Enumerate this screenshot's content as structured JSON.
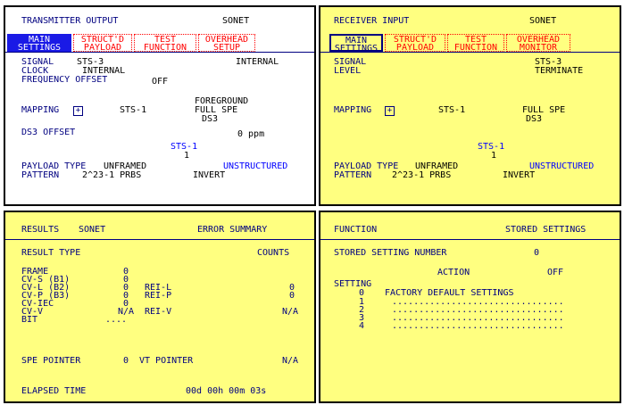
{
  "tx": {
    "title": "TRANSMITTER OUTPUT",
    "mode": "SONET",
    "tabs": [
      {
        "l1": "MAIN",
        "l2": "SETTINGS"
      },
      {
        "l1": "STRUCT'D",
        "l2": "PAYLOAD"
      },
      {
        "l1": "TEST",
        "l2": "FUNCTION"
      },
      {
        "l1": "OVERHEAD",
        "l2": "SETUP"
      }
    ],
    "signal_label": "SIGNAL",
    "signal_value": "STS-3",
    "signal_source": "INTERNAL",
    "clock_label": "CLOCK",
    "clock_value": "INTERNAL",
    "freq_label": "FREQUENCY OFFSET",
    "freq_value": "OFF",
    "fg1": "FOREGROUND",
    "fg2": "FULL SPE",
    "fg3": "DS3",
    "mapping_label": "MAPPING",
    "mapping_icon": "+",
    "mapping_value": "STS-1",
    "ds3_label": "DS3 OFFSET",
    "ds3_value": "0 ppm",
    "sts": "STS-1",
    "sts_num": "1",
    "payload_label": "PAYLOAD TYPE",
    "payload_value": "UNFRAMED",
    "payload_struct": "UNSTRUCTURED",
    "pattern_label": "PATTERN",
    "pattern_value": "2^23-1 PRBS",
    "pattern_mode": "INVERT"
  },
  "rx": {
    "title": "RECEIVER INPUT",
    "mode": "SONET",
    "tabs": [
      {
        "l1": "MAIN",
        "l2": "SETTINGS"
      },
      {
        "l1": "STRUCT'D",
        "l2": "PAYLOAD"
      },
      {
        "l1": "TEST",
        "l2": "FUNCTION"
      },
      {
        "l1": "OVERHEAD",
        "l2": "MONITOR"
      }
    ],
    "signal_label": "SIGNAL",
    "signal_value": "STS-3",
    "level_label": "LEVEL",
    "level_value": "TERMINATE",
    "mapping_label": "MAPPING",
    "mapping_icon": "+",
    "mapping_value": "STS-1",
    "map1": "FULL SPE",
    "map2": "DS3",
    "sts": "STS-1",
    "sts_num": "1",
    "payload_label": "PAYLOAD TYPE",
    "payload_value": "UNFRAMED",
    "payload_struct": "UNSTRUCTURED",
    "pattern_label": "PATTERN",
    "pattern_value": "2^23-1 PRBS",
    "pattern_mode": "INVERT"
  },
  "res": {
    "title": "RESULTS",
    "mode": "SONET",
    "summary": "ERROR SUMMARY",
    "type_label": "RESULT TYPE",
    "counts_label": "COUNTS",
    "frame_label": "FRAME",
    "frame_value": "0",
    "cvs_label": "CV-S (B1)",
    "cvs_value": "0",
    "cvl_label": "CV-L (B2)",
    "cvl_value": "0",
    "reil_label": "REI-L",
    "reil_value": "0",
    "cvp_label": "CV-P (B3)",
    "cvp_value": "0",
    "reip_label": "REI-P",
    "reip_value": "0",
    "cviec_label": "CV-IEC",
    "cviec_value": "0",
    "cvv_label": "CV-V",
    "cvv_value": "N/A",
    "reiv_label": "REI-V",
    "reiv_value": "N/A",
    "bit_label": "BIT",
    "bit_value": "....",
    "spe_label": "SPE POINTER",
    "spe_value": "0",
    "vt_label": "VT POINTER",
    "vt_value": "N/A",
    "elapsed_label": "ELAPSED TIME",
    "elapsed_value": "00d 00h 00m 03s"
  },
  "fn": {
    "title": "FUNCTION",
    "mode": "STORED SETTINGS",
    "num_label": "STORED SETTING NUMBER",
    "num_value": "0",
    "action_label": "ACTION",
    "action_value": "OFF",
    "setting_label": "SETTING",
    "settings": [
      {
        "n": "0",
        "text": "FACTORY DEFAULT SETTINGS"
      },
      {
        "n": "1",
        "text": "................................"
      },
      {
        "n": "2",
        "text": "................................"
      },
      {
        "n": "3",
        "text": "................................"
      },
      {
        "n": "4",
        "text": "................................"
      }
    ]
  }
}
